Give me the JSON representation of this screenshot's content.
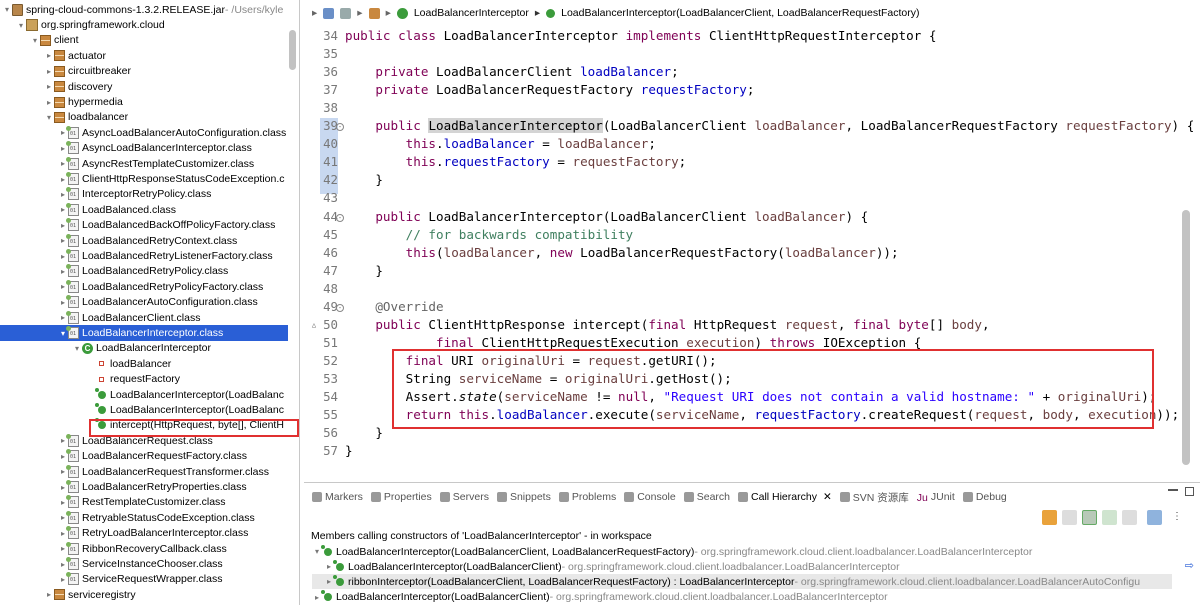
{
  "tree": {
    "items": [
      {
        "label": "spring-cloud-commons-1.3.2.RELEASE.jar",
        "suffix": " - /Users/kyle",
        "icon": "jar",
        "indent": 0,
        "twisty": "▾"
      },
      {
        "label": "org.springframework.cloud",
        "icon": "pkgroot",
        "indent": 1,
        "twisty": "▾"
      },
      {
        "label": "client",
        "icon": "pkg",
        "indent": 2,
        "twisty": "▾"
      },
      {
        "label": "actuator",
        "icon": "pkg",
        "indent": 3,
        "twisty": "▸"
      },
      {
        "label": "circuitbreaker",
        "icon": "pkg",
        "indent": 3,
        "twisty": "▸"
      },
      {
        "label": "discovery",
        "icon": "pkg",
        "indent": 3,
        "twisty": "▸"
      },
      {
        "label": "hypermedia",
        "icon": "pkg",
        "indent": 3,
        "twisty": "▸"
      },
      {
        "label": "loadbalancer",
        "icon": "pkg",
        "indent": 3,
        "twisty": "▾"
      },
      {
        "label": "AsyncLoadBalancerAutoConfiguration.class",
        "icon": "cls",
        "indent": 4,
        "twisty": "▸"
      },
      {
        "label": "AsyncLoadBalancerInterceptor.class",
        "icon": "cls",
        "indent": 4,
        "twisty": "▸"
      },
      {
        "label": "AsyncRestTemplateCustomizer.class",
        "icon": "cls",
        "indent": 4,
        "twisty": "▸"
      },
      {
        "label": "ClientHttpResponseStatusCodeException.c",
        "icon": "cls",
        "indent": 4,
        "twisty": "▸"
      },
      {
        "label": "InterceptorRetryPolicy.class",
        "icon": "cls",
        "indent": 4,
        "twisty": "▸"
      },
      {
        "label": "LoadBalanced.class",
        "icon": "cls",
        "indent": 4,
        "twisty": "▸"
      },
      {
        "label": "LoadBalancedBackOffPolicyFactory.class",
        "icon": "cls",
        "indent": 4,
        "twisty": "▸"
      },
      {
        "label": "LoadBalancedRetryContext.class",
        "icon": "cls",
        "indent": 4,
        "twisty": "▸"
      },
      {
        "label": "LoadBalancedRetryListenerFactory.class",
        "icon": "cls",
        "indent": 4,
        "twisty": "▸"
      },
      {
        "label": "LoadBalancedRetryPolicy.class",
        "icon": "cls",
        "indent": 4,
        "twisty": "▸"
      },
      {
        "label": "LoadBalancedRetryPolicyFactory.class",
        "icon": "cls",
        "indent": 4,
        "twisty": "▸"
      },
      {
        "label": "LoadBalancerAutoConfiguration.class",
        "icon": "cls",
        "indent": 4,
        "twisty": "▸"
      },
      {
        "label": "LoadBalancerClient.class",
        "icon": "cls",
        "indent": 4,
        "twisty": "▸"
      },
      {
        "label": "LoadBalancerInterceptor.class",
        "icon": "cls",
        "indent": 4,
        "twisty": "▾",
        "selected": true
      },
      {
        "label": "LoadBalancerInterceptor",
        "icon": "ccirc",
        "indent": 5,
        "twisty": "▾"
      },
      {
        "label": "loadBalancer",
        "icon": "field",
        "indent": 6,
        "twisty": ""
      },
      {
        "label": "requestFactory",
        "icon": "field",
        "indent": 6,
        "twisty": ""
      },
      {
        "label": "LoadBalancerInterceptor(LoadBalanc",
        "icon": "meth",
        "indent": 6,
        "twisty": ""
      },
      {
        "label": "LoadBalancerInterceptor(LoadBalanc",
        "icon": "meth",
        "indent": 6,
        "twisty": ""
      },
      {
        "label": "intercept(HttpRequest, byte[], ClientH",
        "icon": "meth",
        "indent": 6,
        "twisty": ""
      },
      {
        "label": "LoadBalancerRequest.class",
        "icon": "cls",
        "indent": 4,
        "twisty": "▸"
      },
      {
        "label": "LoadBalancerRequestFactory.class",
        "icon": "cls",
        "indent": 4,
        "twisty": "▸"
      },
      {
        "label": "LoadBalancerRequestTransformer.class",
        "icon": "cls",
        "indent": 4,
        "twisty": "▸"
      },
      {
        "label": "LoadBalancerRetryProperties.class",
        "icon": "cls",
        "indent": 4,
        "twisty": "▸"
      },
      {
        "label": "RestTemplateCustomizer.class",
        "icon": "cls",
        "indent": 4,
        "twisty": "▸"
      },
      {
        "label": "RetryableStatusCodeException.class",
        "icon": "cls",
        "indent": 4,
        "twisty": "▸"
      },
      {
        "label": "RetryLoadBalancerInterceptor.class",
        "icon": "cls",
        "indent": 4,
        "twisty": "▸"
      },
      {
        "label": "RibbonRecoveryCallback.class",
        "icon": "cls",
        "indent": 4,
        "twisty": "▸"
      },
      {
        "label": "ServiceInstanceChooser.class",
        "icon": "cls",
        "indent": 4,
        "twisty": "▸"
      },
      {
        "label": "ServiceRequestWrapper.class",
        "icon": "cls",
        "indent": 4,
        "twisty": "▸"
      },
      {
        "label": "serviceregistry",
        "icon": "pkg",
        "indent": 3,
        "twisty": "▸"
      }
    ]
  },
  "breadcrumb": {
    "class": "LoadBalancerInterceptor",
    "method": "LoadBalancerInterceptor(LoadBalancerClient, LoadBalancerRequestFactory)"
  },
  "code": {
    "lines": [
      {
        "n": "34",
        "html": "<span class='kw'>public class</span> LoadBalancerInterceptor <span class='kw'>implements</span> ClientHttpRequestInterceptor {"
      },
      {
        "n": "35",
        "html": ""
      },
      {
        "n": "36",
        "html": "    <span class='kw'>private</span> LoadBalancerClient <span class='fd'>loadBalancer</span>;"
      },
      {
        "n": "37",
        "html": "    <span class='kw'>private</span> LoadBalancerRequestFactory <span class='fd'>requestFactory</span>;"
      },
      {
        "n": "38",
        "html": ""
      },
      {
        "n": "39",
        "html": "    <span class='kw'>public</span> <span class='hl'>LoadBalancerInterceptor</span>(LoadBalancerClient <span class='pm'>loadBalancer</span>, LoadBalancerRequestFactory <span class='pm'>requestFactory</span>) {",
        "fold": true
      },
      {
        "n": "40",
        "html": "        <span class='kw'>this</span>.<span class='fd'>loadBalancer</span> = <span class='pm'>loadBalancer</span>;"
      },
      {
        "n": "41",
        "html": "        <span class='kw'>this</span>.<span class='fd'>requestFactory</span> = <span class='pm'>requestFactory</span>;"
      },
      {
        "n": "42",
        "html": "    }"
      },
      {
        "n": "43",
        "html": ""
      },
      {
        "n": "44",
        "html": "    <span class='kw'>public</span> LoadBalancerInterceptor(LoadBalancerClient <span class='pm'>loadBalancer</span>) {",
        "fold": true
      },
      {
        "n": "45",
        "html": "        <span class='cm'>// for backwards compatibility</span>"
      },
      {
        "n": "46",
        "html": "        <span class='kw'>this</span>(<span class='pm'>loadBalancer</span>, <span class='kw'>new</span> LoadBalancerRequestFactory(<span class='pm'>loadBalancer</span>));"
      },
      {
        "n": "47",
        "html": "    }"
      },
      {
        "n": "48",
        "html": ""
      },
      {
        "n": "49",
        "html": "    <span class='an'>@Override</span>",
        "fold": true
      },
      {
        "n": "50",
        "html": "    <span class='kw'>public</span> ClientHttpResponse intercept(<span class='kw'>final</span> HttpRequest <span class='pm'>request</span>, <span class='kw'>final byte</span>[] <span class='pm'>body</span>,",
        "override": true
      },
      {
        "n": "51",
        "html": "            <span class='kw'>final</span> ClientHttpRequestExecution <span class='pm'>execution</span>) <span class='kw'>throws</span> IOException {"
      },
      {
        "n": "52",
        "html": "        <span class='kw'>final</span> URI <span class='pm'>originalUri</span> = <span class='pm'>request</span>.getURI();"
      },
      {
        "n": "53",
        "html": "        String <span class='pm'>serviceName</span> = <span class='pm'>originalUri</span>.getHost();"
      },
      {
        "n": "54",
        "html": "        Assert.<span class='it'>state</span>(<span class='pm'>serviceName</span> != <span class='kw'>null</span>, <span class='st'>\"Request URI does not contain a valid hostname: \"</span> + <span class='pm'>originalUri</span>);"
      },
      {
        "n": "55",
        "html": "        <span class='kw'>return this</span>.<span class='fd'>loadBalancer</span>.execute(<span class='pm'>serviceName</span>, <span class='fd'>requestFactory</span>.createRequest(<span class='pm'>request</span>, <span class='pm'>body</span>, <span class='pm'>execution</span>));"
      },
      {
        "n": "56",
        "html": "    }"
      },
      {
        "n": "57",
        "html": "}"
      }
    ]
  },
  "panel": {
    "tabs": [
      {
        "label": "Markers",
        "icon": "markers-icon"
      },
      {
        "label": "Properties",
        "icon": "properties-icon"
      },
      {
        "label": "Servers",
        "icon": "servers-icon"
      },
      {
        "label": "Snippets",
        "icon": "snippets-icon"
      },
      {
        "label": "Problems",
        "icon": "problems-icon"
      },
      {
        "label": "Console",
        "icon": "console-icon"
      },
      {
        "label": "Search",
        "icon": "search-icon"
      },
      {
        "label": "Call Hierarchy",
        "icon": "call-hierarchy-icon",
        "active": true,
        "close": "✕"
      },
      {
        "label": "SVN 资源库",
        "icon": "svn-icon"
      },
      {
        "label": "JUnit",
        "icon": "junit-icon",
        "prefix": "Ju"
      },
      {
        "label": "Debug",
        "icon": "debug-icon"
      }
    ],
    "title": "Members calling constructors of 'LoadBalancerInterceptor' - in workspace",
    "rows": [
      {
        "main": "LoadBalancerInterceptor(LoadBalancerClient, LoadBalancerRequestFactory)",
        "loc": " - org.springframework.cloud.client.loadbalancer.LoadBalancerInterceptor",
        "indent": 0,
        "twisty": "▾"
      },
      {
        "main": "LoadBalancerInterceptor(LoadBalancerClient)",
        "loc": " - org.springframework.cloud.client.loadbalancer.LoadBalancerInterceptor",
        "indent": 1,
        "twisty": "▸"
      },
      {
        "main": "ribbonInterceptor(LoadBalancerClient, LoadBalancerRequestFactory) : LoadBalancerInterceptor",
        "loc": " - org.springframework.cloud.client.loadbalancer.LoadBalancerAutoConfigu",
        "indent": 1,
        "twisty": "▸",
        "selected": true
      },
      {
        "main": "LoadBalancerInterceptor(LoadBalancerClient)",
        "loc": " - org.springframework.cloud.client.loadbalancer.LoadBalancerInterceptor",
        "indent": 0,
        "twisty": "▸"
      }
    ]
  }
}
